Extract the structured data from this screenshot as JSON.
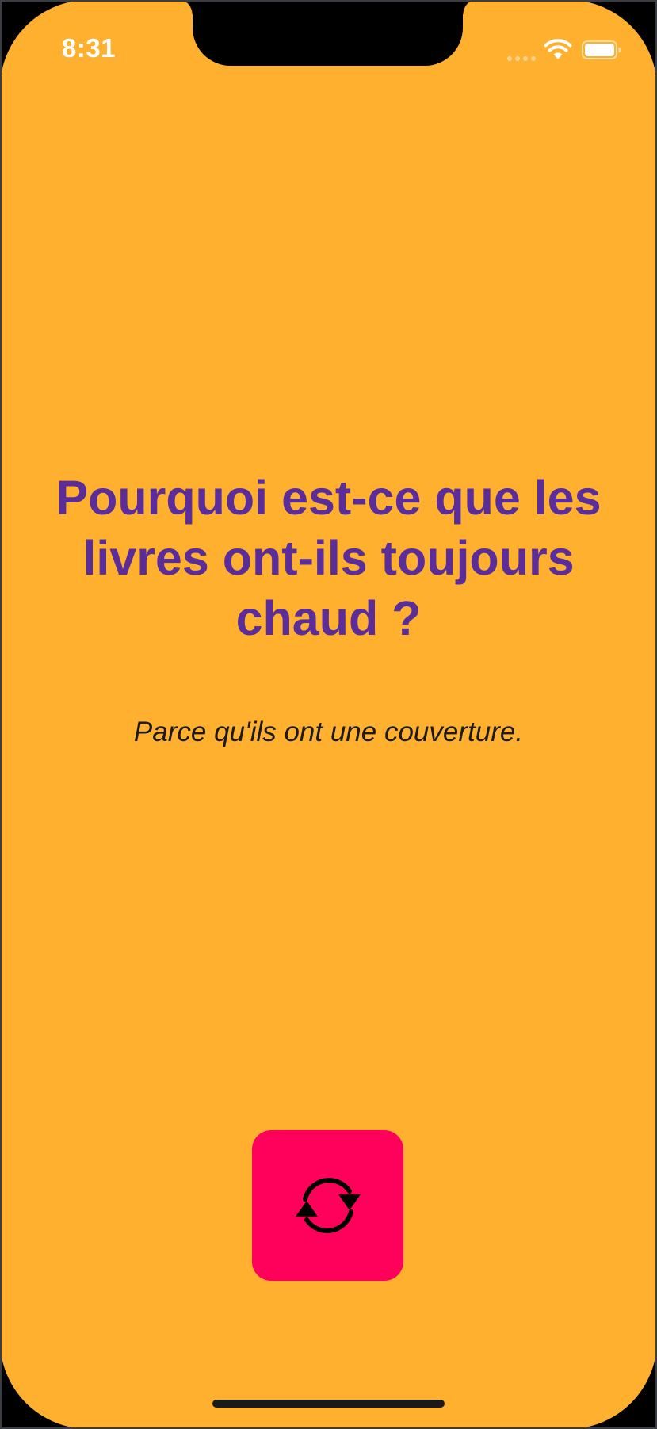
{
  "status_bar": {
    "time": "8:31",
    "wifi_icon": "wifi-icon",
    "battery_icon": "battery-icon"
  },
  "joke": {
    "question": "Pourquoi est-ce que les livres ont-ils toujours chaud ?",
    "answer": "Parce qu'ils ont une couverture."
  },
  "actions": {
    "refresh_icon": "refresh-icon",
    "refresh_button_color": "#FF005B"
  },
  "colors": {
    "background": "#FFB02E",
    "question_text": "#5A2D9A",
    "answer_text": "#1e1a1f"
  }
}
